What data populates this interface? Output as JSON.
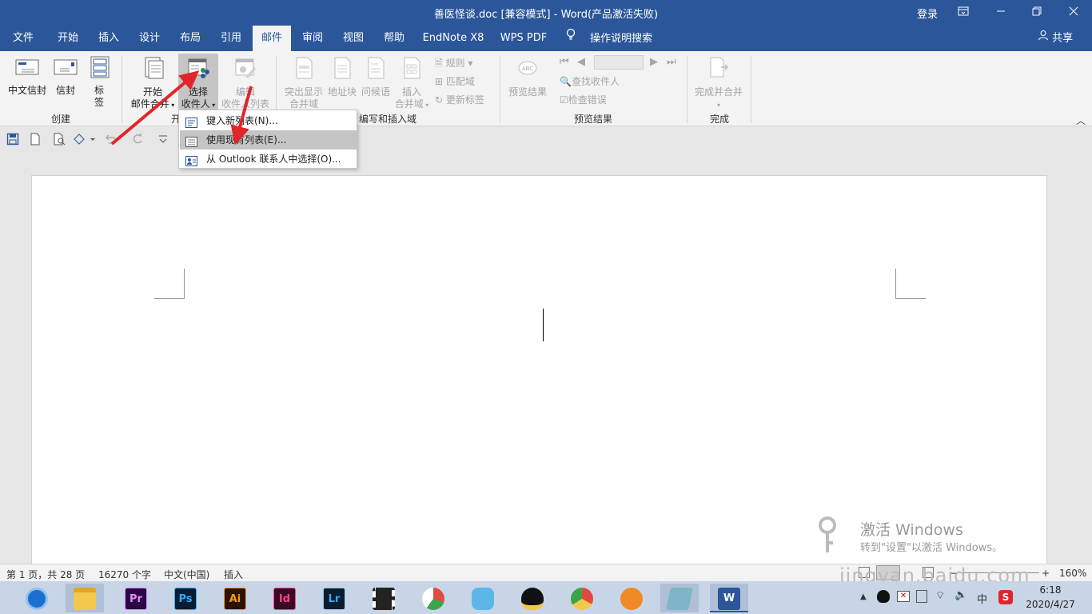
{
  "window": {
    "title": "善医怪谈.doc [兼容模式]  -  Word(产品激活失败)",
    "login": "登录",
    "share": "共享"
  },
  "tabs": [
    {
      "label": "文件"
    },
    {
      "label": "开始"
    },
    {
      "label": "插入"
    },
    {
      "label": "设计"
    },
    {
      "label": "布局"
    },
    {
      "label": "引用"
    },
    {
      "label": "邮件",
      "active": true
    },
    {
      "label": "审阅"
    },
    {
      "label": "视图"
    },
    {
      "label": "帮助"
    },
    {
      "label": "EndNote X8"
    },
    {
      "label": "WPS PDF"
    }
  ],
  "tell_me": "操作说明搜索",
  "ribbon": {
    "create": {
      "group_label": "创建",
      "chinese_envelope": "中文信封",
      "envelope": "信封",
      "labels_line1": "标",
      "labels_line2": "签"
    },
    "start": {
      "group_label": "开",
      "start_merge_line1": "开始",
      "start_merge_line2": "邮件合并",
      "select_recipients_line1": "选择",
      "select_recipients_line2": "收件人",
      "edit_list_line1": "编辑",
      "edit_list_line2": "收件人列表"
    },
    "write": {
      "group_label": "编写和插入域",
      "highlight_line1": "突出显示",
      "highlight_line2": "合并域",
      "address_block": "地址块",
      "greeting": "问候语",
      "insert_field_line1": "插入",
      "insert_field_line2": "合并域",
      "rules": "规则",
      "match_fields": "匹配域",
      "update_labels": "更新标签"
    },
    "preview": {
      "group_label": "预览结果",
      "preview_results": "预览结果",
      "find_recipient": "查找收件人",
      "check_errors": "检查错误"
    },
    "finish": {
      "group_label": "完成",
      "finish_merge": "完成并合并"
    }
  },
  "dropdown_menu": {
    "items": [
      {
        "label": "键入新列表(N)..."
      },
      {
        "label": "使用现有列表(E)...",
        "highlighted": true
      },
      {
        "label": "从 Outlook 联系人中选择(O)..."
      }
    ]
  },
  "status_bar": {
    "page": "第 1 页，共 28 页",
    "words": "16270 个字",
    "language": "中文(中国)",
    "mode": "插入",
    "zoom": "160%"
  },
  "watermark": {
    "line1": "激活 Windows",
    "line2": "转到\"设置\"以激活 Windows。",
    "site": "jingyan.baidu.com"
  },
  "taskbar": {
    "apps": [
      {
        "name": "browser-icon",
        "text": ""
      },
      {
        "name": "file-explorer-icon",
        "text": ""
      },
      {
        "name": "premiere-icon",
        "text": "Pr",
        "color": "#2a0845"
      },
      {
        "name": "photoshop-icon",
        "text": "Ps",
        "color": "#071d33"
      },
      {
        "name": "illustrator-icon",
        "text": "Ai",
        "color": "#2b1200"
      },
      {
        "name": "indesign-icon",
        "text": "Id",
        "color": "#3a0a22"
      },
      {
        "name": "lightroom-icon",
        "text": "Lr",
        "color": "#0a1d2e"
      },
      {
        "name": "video-icon",
        "text": "",
        "color": "#222222"
      },
      {
        "name": "pie-app-icon",
        "text": "",
        "color": "#e04a3f"
      },
      {
        "name": "chat-app-icon",
        "text": "",
        "color": "#5cb7e8"
      },
      {
        "name": "qq-icon",
        "text": "",
        "color": "#111111"
      },
      {
        "name": "chrome-icon",
        "text": "",
        "color": "#e04a3f"
      },
      {
        "name": "fox-app-icon",
        "text": "",
        "color": "#f08a24"
      },
      {
        "name": "notes-app-icon",
        "text": "",
        "color": "#7fb5c9"
      },
      {
        "name": "word-icon",
        "text": "W",
        "color": "#2b579a"
      }
    ],
    "time": "6:18",
    "date": "2020/4/27",
    "ime": "中"
  },
  "colors": {
    "accent": "#2b579a",
    "arrow": "#e0262a"
  }
}
